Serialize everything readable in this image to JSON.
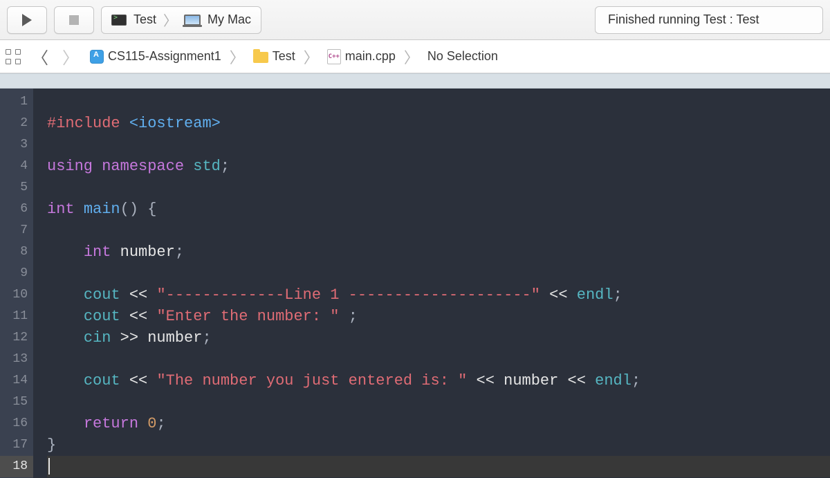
{
  "toolbar": {
    "scheme_target": "Test",
    "scheme_device": "My Mac",
    "status": "Finished running Test : Test"
  },
  "jumpbar": {
    "project": "CS115-Assignment1",
    "folder": "Test",
    "file": "main.cpp",
    "cpp_badge": "C++",
    "selection": "No Selection"
  },
  "editor": {
    "line_count": 18,
    "current_line": 18,
    "tokens": {
      "l2_include": "#include ",
      "l2_header": "<iostream>",
      "l4_using": "using ",
      "l4_namespace": "namespace ",
      "l4_std": "std",
      "l4_semi": ";",
      "l6_int": "int ",
      "l6_main": "main",
      "l6_paren": "() {",
      "l8_indent": "    ",
      "l8_int": "int ",
      "l8_number": "number",
      "l8_semi": ";",
      "l10_indent": "    ",
      "l10_cout": "cout",
      "l10_op": " << ",
      "l10_str": "\"-------------Line 1 --------------------\"",
      "l10_op2": " << ",
      "l10_endl": "endl",
      "l10_semi": ";",
      "l11_indent": "    ",
      "l11_cout": "cout",
      "l11_op": " << ",
      "l11_str": "\"Enter the number: \"",
      "l11_space": " ",
      "l11_semi": ";",
      "l12_indent": "    ",
      "l12_cin": "cin",
      "l12_op": " >> ",
      "l12_number": "number",
      "l12_semi": ";",
      "l14_indent": "    ",
      "l14_cout": "cout",
      "l14_op": " << ",
      "l14_str": "\"The number you just entered is: \"",
      "l14_op2": " << ",
      "l14_number": "number",
      "l14_op3": " << ",
      "l14_endl": "endl",
      "l14_semi": ";",
      "l16_indent": "    ",
      "l16_return": "return ",
      "l16_zero": "0",
      "l16_semi": ";",
      "l17_brace": "}"
    }
  }
}
